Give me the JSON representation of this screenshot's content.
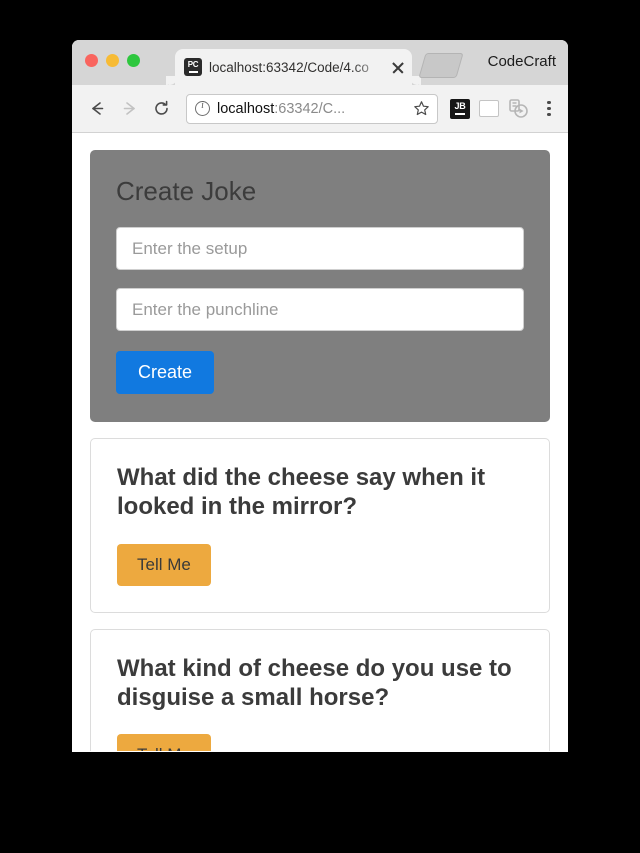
{
  "window": {
    "traffic_lights": [
      {
        "name": "close",
        "color": "#f9655f"
      },
      {
        "name": "minimize",
        "color": "#f7bb35"
      },
      {
        "name": "maximize",
        "color": "#2ec73e"
      }
    ],
    "tab": {
      "favicon_label": "PC",
      "title": "localhost:63342/Code/4.co",
      "close_label": ""
    },
    "profile_label": "CodeCraft"
  },
  "toolbar": {
    "back_icon": "arrow-left-icon",
    "forward_icon": "arrow-right-icon",
    "reload_icon": "reload-icon",
    "omnibox": {
      "info_icon": "info-circle-icon",
      "host": "localhost",
      "path": ":63342/C...",
      "star_icon": "star-icon"
    },
    "extensions": [
      {
        "name": "jetbrains-extension",
        "label": "JB"
      },
      {
        "name": "blank-page-extension",
        "label": ""
      },
      {
        "name": "disabled-extension",
        "label": ""
      }
    ],
    "menu_icon": "three-dots-menu-icon"
  },
  "page": {
    "create_panel": {
      "heading": "Create Joke",
      "setup_input": {
        "value": "",
        "placeholder": "Enter the setup"
      },
      "punchline_input": {
        "value": "",
        "placeholder": "Enter the punchline"
      },
      "create_button": "Create",
      "panel_color": "#7f7f7f",
      "button_color": "#1179e0"
    },
    "jokes": [
      {
        "setup": "What did the cheese say when it looked in the mirror?",
        "button": "Tell Me"
      },
      {
        "setup": "What kind of cheese do you use to disguise a small horse?",
        "button": "Tell Me"
      }
    ],
    "joke_button_color": "#eda93f"
  }
}
